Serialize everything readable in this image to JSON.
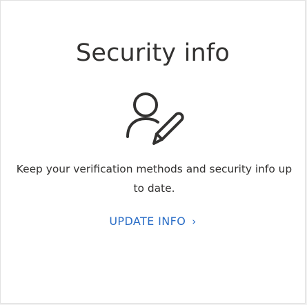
{
  "card": {
    "title": "Security info",
    "icon": "user-edit-icon",
    "description": "Keep your verification methods and security info up to date.",
    "link_label": "UPDATE INFO",
    "link_chevron": "›",
    "link_color": "#2b6ec7",
    "text_color": "#323130"
  }
}
